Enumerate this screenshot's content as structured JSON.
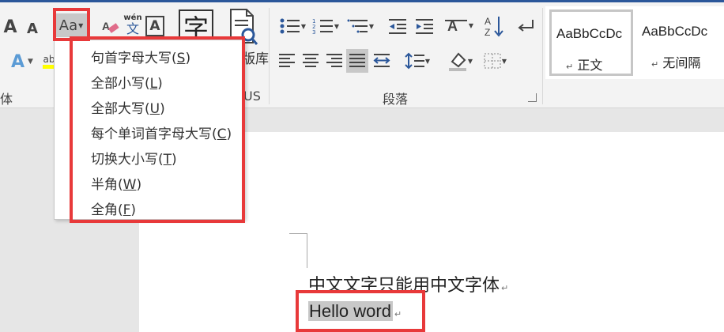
{
  "ribbon": {
    "font_group_label": "体",
    "paragraph_group_label": "段落",
    "thesaurus_partial_label": "US",
    "library_partial_label": "版库",
    "grow_font_label": "A",
    "shrink_font_label": "A",
    "change_case_label": "Aa",
    "phonetic_top": "wén",
    "phonetic_bottom": "文",
    "char_border_label": "A",
    "big_char_label": "字",
    "text_effect_label": "A",
    "highlight_label": "ab",
    "sort_label": "A Z"
  },
  "styles": [
    {
      "sample": "AaBbCcDc",
      "name": "正文"
    },
    {
      "sample": "AaBbCcDc",
      "name": "无间隔"
    }
  ],
  "change_case_menu": {
    "items": [
      {
        "label": "句首字母大写(",
        "key": "S",
        "close": ")"
      },
      {
        "label": "全部小写(",
        "key": "L",
        "close": ")"
      },
      {
        "label": "全部大写(",
        "key": "U",
        "close": ")"
      },
      {
        "label": "每个单词首字母大写(",
        "key": "C",
        "close": ")"
      },
      {
        "label": "切换大小写(",
        "key": "T",
        "close": ")"
      },
      {
        "label": "半角(",
        "key": "W",
        "close": ")"
      },
      {
        "label": "全角(",
        "key": "F",
        "close": ")"
      }
    ]
  },
  "document": {
    "line1": "中文文字只能用中文字体",
    "line2": "Hello word",
    "para_mark": "↵"
  },
  "colors": {
    "highlight_red": "#e8393a",
    "accent_blue": "#2b579a",
    "selection_gray": "#c8c8c8"
  }
}
